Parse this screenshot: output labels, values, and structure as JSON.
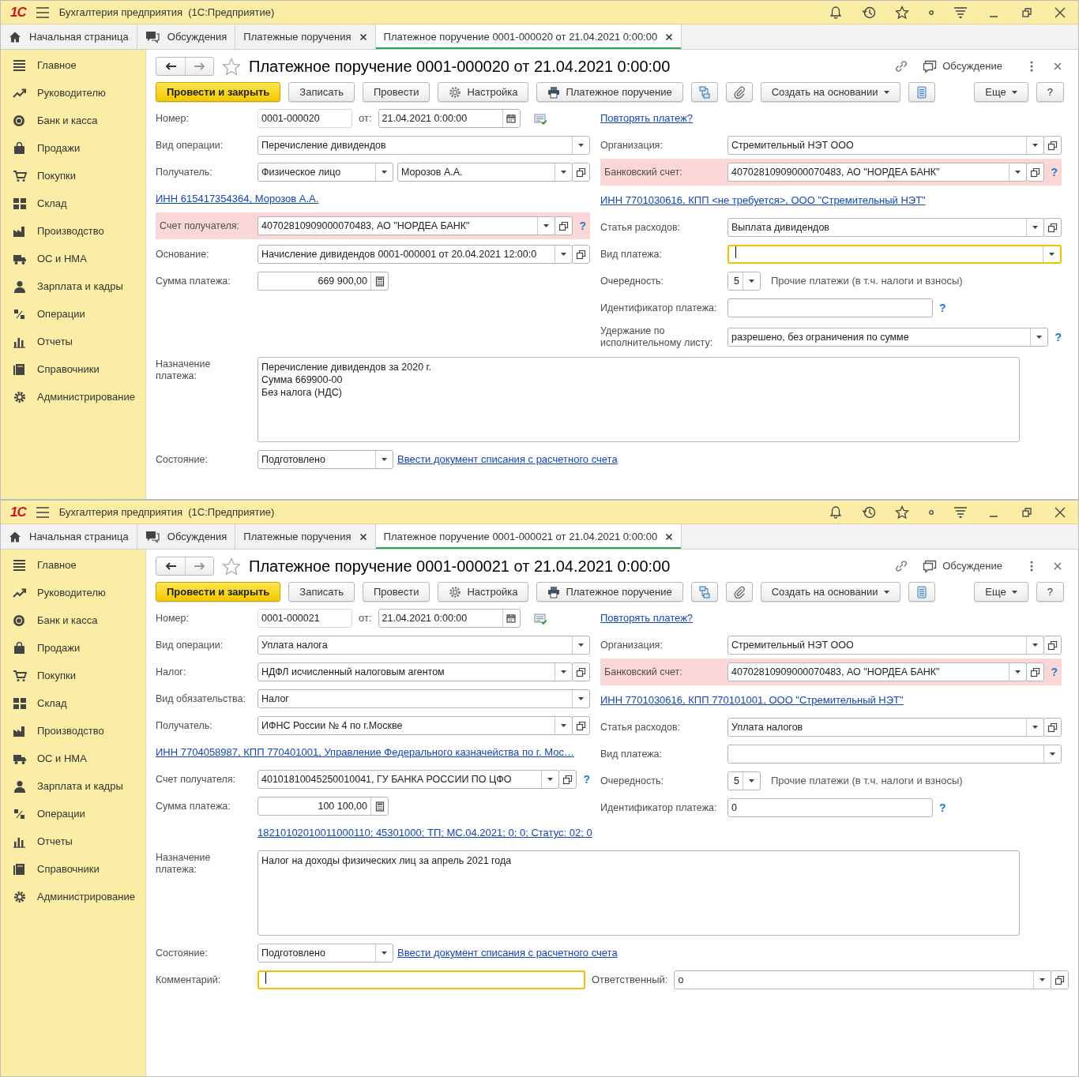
{
  "windows": [
    {
      "logo": "1С",
      "app_title": "Бухгалтерия предприятия  (1С:Предприятие)",
      "tabs": [
        {
          "label": "Начальная страница",
          "closable": false,
          "selected": false
        },
        {
          "label": "Обсуждения",
          "closable": false,
          "selected": false
        },
        {
          "label": "Платежные поручения",
          "closable": true,
          "selected": false
        },
        {
          "label": "Платежное поручение 0001-000020 от 21.04.2021 0:00:00",
          "closable": true,
          "selected": true
        }
      ],
      "sidebar": [
        "Главное",
        "Руководителю",
        "Банк и касса",
        "Продажи",
        "Покупки",
        "Склад",
        "Производство",
        "ОС и НМА",
        "Зарплата и кадры",
        "Операции",
        "Отчеты",
        "Справочники",
        "Администрирование"
      ],
      "form_title": "Платежное поручение 0001-000020 от 21.04.2021 0:00:00",
      "discussion": "Обсуждение",
      "toolbar": [
        {
          "kind": "primary",
          "label": "Провести и закрыть"
        },
        {
          "kind": "button",
          "label": "Записать"
        },
        {
          "kind": "button",
          "label": "Провести"
        },
        {
          "kind": "settings",
          "label": "Настройка"
        },
        {
          "kind": "print",
          "label": "Платежное поручение"
        },
        {
          "kind": "structure"
        },
        {
          "kind": "attach"
        },
        {
          "kind": "menu",
          "label": "Создать на основании"
        },
        {
          "kind": "list"
        }
      ],
      "toolbar_right": [
        {
          "kind": "menu",
          "label": "Еще"
        },
        {
          "kind": "button",
          "label": "?"
        }
      ],
      "form": {
        "left": [
          {
            "kind": "field",
            "label": "Номер:",
            "controls": [
              {
                "kind": "number",
                "value": "0001-000020"
              },
              {
                "kind": "label",
                "text": "от:"
              },
              {
                "kind": "date",
                "value": "21.04.2021  0:00:00"
              },
              {
                "kind": "doc-icon"
              }
            ]
          },
          {
            "kind": "field",
            "label": "Вид операции:",
            "controls": [
              {
                "kind": "select",
                "value": "Перечисление дивидендов",
                "dropdown": true
              }
            ]
          },
          {
            "kind": "field",
            "label": "Получатель:",
            "controls": [
              {
                "kind": "select-fixed",
                "value": "Физическое лицо",
                "dropdown": true
              },
              {
                "kind": "select",
                "value": "Морозов А.А.",
                "dropdown": true,
                "open_button": true
              }
            ]
          },
          {
            "kind": "link",
            "text": "ИНН 615417354364, Морозов А.А."
          },
          {
            "kind": "field",
            "label": "Счет получателя:",
            "highlighted": true,
            "controls": [
              {
                "kind": "select",
                "value": "40702810909000070483, АО \"НОРДЕА БАНК\"",
                "dropdown": true,
                "open_button": true
              },
              {
                "kind": "help",
                "text": "?"
              }
            ]
          },
          {
            "kind": "field",
            "label": "Основание:",
            "controls": [
              {
                "kind": "select",
                "value": "Начисление дивидендов 0001-000001 от 20.04.2021 12:00:0",
                "dropdown": true,
                "open_button": true
              }
            ]
          },
          {
            "kind": "field",
            "label": "Сумма платежа:",
            "controls": [
              {
                "kind": "amount",
                "value": "669 900,00"
              }
            ]
          }
        ],
        "right": [
          {
            "kind": "link",
            "text": "Повторять платеж?"
          },
          {
            "kind": "field",
            "label": "Организация:",
            "controls": [
              {
                "kind": "select",
                "value": "Стремительный НЭТ ООО",
                "dropdown": true,
                "open_button": true
              }
            ]
          },
          {
            "kind": "field",
            "label": "Банковский счет:",
            "highlighted": true,
            "controls": [
              {
                "kind": "select",
                "value": "40702810909000070483, АО \"НОРДЕА БАНК\"",
                "dropdown": true,
                "open_button": true
              },
              {
                "kind": "help",
                "text": "?"
              }
            ]
          },
          {
            "kind": "link",
            "text": "ИНН 7701030616, КПП <не требуется>, ООО \"Стремительный НЭТ\""
          },
          {
            "kind": "field",
            "label": "Статья расходов:",
            "controls": [
              {
                "kind": "select",
                "value": "Выплата дивидендов",
                "dropdown": true,
                "open_button": true
              }
            ]
          },
          {
            "kind": "field",
            "label": "Вид платежа:",
            "controls": [
              {
                "kind": "select",
                "focused": true,
                "dropdown": true
              }
            ]
          },
          {
            "kind": "field",
            "label": "Очередность:",
            "controls": [
              {
                "kind": "priority",
                "value": "5",
                "dropdown": true
              },
              {
                "kind": "note",
                "text": "Прочие платежи (в т.ч. налоги и взносы)"
              }
            ]
          },
          {
            "kind": "field",
            "label": "Идентификатор платежа:",
            "controls": [
              {
                "kind": "id"
              },
              {
                "kind": "help",
                "text": "?"
              }
            ]
          },
          {
            "kind": "field",
            "label": "Удержание по исполнительному листу:",
            "controls": [
              {
                "kind": "select",
                "value": "разрешено, без ограничения по сумме",
                "dropdown": true
              },
              {
                "kind": "help",
                "text": "?"
              }
            ]
          }
        ],
        "bottom": [
          {
            "kind": "field",
            "label": "Назначение платежа:",
            "controls": [
              {
                "kind": "textarea",
                "lines": [
                  "Перечисление дивидендов за 2020 г.",
                  "Сумма 669900-00",
                  "Без налога (НДС)"
                ]
              }
            ]
          },
          {
            "kind": "field",
            "label": "Состояние:",
            "controls": [
              {
                "kind": "select-fixed",
                "value": "Подготовлено",
                "dropdown": true
              },
              {
                "kind": "link",
                "text": "Ввести документ списания с расчетного счета"
              }
            ]
          }
        ]
      }
    },
    {
      "logo": "1С",
      "app_title": "Бухгалтерия предприятия  (1С:Предприятие)",
      "tabs": [
        {
          "label": "Начальная страница",
          "closable": false,
          "selected": false
        },
        {
          "label": "Обсуждения",
          "closable": false,
          "selected": false
        },
        {
          "label": "Платежные поручения",
          "closable": true,
          "selected": false
        },
        {
          "label": "Платежное поручение 0001-000021 от 21.04.2021 0:00:00",
          "closable": true,
          "selected": true
        }
      ],
      "sidebar": [
        "Главное",
        "Руководителю",
        "Банк и касса",
        "Продажи",
        "Покупки",
        "Склад",
        "Производство",
        "ОС и НМА",
        "Зарплата и кадры",
        "Операции",
        "Отчеты",
        "Справочники",
        "Администрирование"
      ],
      "form_title": "Платежное поручение 0001-000021 от 21.04.2021 0:00:00",
      "discussion": "Обсуждение",
      "toolbar": [
        {
          "kind": "primary",
          "label": "Провести и закрыть"
        },
        {
          "kind": "button",
          "label": "Записать"
        },
        {
          "kind": "button",
          "label": "Провести"
        },
        {
          "kind": "settings",
          "label": "Настройка"
        },
        {
          "kind": "print",
          "label": "Платежное поручение"
        },
        {
          "kind": "structure"
        },
        {
          "kind": "attach"
        },
        {
          "kind": "menu",
          "label": "Создать на основании"
        },
        {
          "kind": "list"
        }
      ],
      "toolbar_right": [
        {
          "kind": "menu",
          "label": "Еще"
        },
        {
          "kind": "button",
          "label": "?"
        }
      ],
      "form": {
        "left": [
          {
            "kind": "field",
            "label": "Номер:",
            "controls": [
              {
                "kind": "number",
                "value": "0001-000021"
              },
              {
                "kind": "label",
                "text": "от:"
              },
              {
                "kind": "date",
                "value": "21.04.2021  0:00:00"
              },
              {
                "kind": "doc-icon"
              }
            ]
          },
          {
            "kind": "field",
            "label": "Вид операции:",
            "controls": [
              {
                "kind": "select",
                "value": "Уплата налога",
                "dropdown": true
              }
            ]
          },
          {
            "kind": "field",
            "label": "Налог:",
            "controls": [
              {
                "kind": "select",
                "value": "НДФЛ исчисленный налоговым агентом",
                "dropdown": true,
                "open_button": true
              }
            ]
          },
          {
            "kind": "field",
            "label": "Вид обязательства:",
            "controls": [
              {
                "kind": "select",
                "value": "Налог",
                "dropdown": true
              }
            ]
          },
          {
            "kind": "field",
            "label": "Получатель:",
            "controls": [
              {
                "kind": "select",
                "value": "ИФНС России № 4 по г.Москве",
                "dropdown": true,
                "open_button": true
              }
            ]
          },
          {
            "kind": "link",
            "text": "ИНН 7704058987, КПП 770401001, Управление Федерального казначейства по г. Мос…"
          },
          {
            "kind": "field",
            "label": "Счет получателя:",
            "controls": [
              {
                "kind": "select",
                "value": "40101810045250010041, ГУ БАНКА РОССИИ ПО ЦФО",
                "dropdown": true,
                "open_button": true
              },
              {
                "kind": "help",
                "text": "?"
              }
            ]
          },
          {
            "kind": "field",
            "label": "Сумма платежа:",
            "controls": [
              {
                "kind": "amount",
                "value": "100 100,00"
              }
            ]
          },
          {
            "kind": "field",
            "controls": [
              {
                "kind": "link",
                "text": "18210102010011000110; 45301000; ТП; МС.04.2021; 0; 0; Статус: 02; 0"
              }
            ]
          }
        ],
        "right": [
          {
            "kind": "link",
            "text": "Повторять платеж?"
          },
          {
            "kind": "field",
            "label": "Организация:",
            "controls": [
              {
                "kind": "select",
                "value": "Стремительный НЭТ ООО",
                "dropdown": true,
                "open_button": true
              }
            ]
          },
          {
            "kind": "field",
            "label": "Банковский счет:",
            "highlighted": true,
            "controls": [
              {
                "kind": "select",
                "value": "40702810909000070483, АО \"НОРДЕА БАНК\"",
                "dropdown": true,
                "open_button": true
              },
              {
                "kind": "help",
                "text": "?"
              }
            ]
          },
          {
            "kind": "link",
            "text": "ИНН 7701030616, КПП 770101001, ООО \"Стремительный НЭТ\""
          },
          {
            "kind": "field",
            "label": "Статья расходов:",
            "controls": [
              {
                "kind": "select",
                "value": "Уплата налогов",
                "dropdown": true,
                "open_button": true
              }
            ]
          },
          {
            "kind": "field",
            "label": "Вид платежа:",
            "controls": [
              {
                "kind": "select",
                "dropdown": true
              }
            ]
          },
          {
            "kind": "field",
            "label": "Очередность:",
            "controls": [
              {
                "kind": "priority",
                "value": "5",
                "dropdown": true
              },
              {
                "kind": "note",
                "text": "Прочие платежи (в т.ч. налоги и взносы)"
              }
            ]
          },
          {
            "kind": "field",
            "label": "Идентификатор платежа:",
            "controls": [
              {
                "kind": "id",
                "value": "0"
              },
              {
                "kind": "help",
                "text": "?"
              }
            ]
          }
        ],
        "bottom": [
          {
            "kind": "field",
            "label": "Назначение платежа:",
            "controls": [
              {
                "kind": "textarea",
                "lines": [
                  "Налог на доходы физических лиц за апрель 2021 года"
                ]
              }
            ]
          },
          {
            "kind": "field",
            "label": "Состояние:",
            "controls": [
              {
                "kind": "select-fixed",
                "value": "Подготовлено",
                "dropdown": true
              },
              {
                "kind": "link",
                "text": "Ввести документ списания с расчетного счета"
              }
            ]
          },
          {
            "kind": "field",
            "label": "Комментарий:",
            "controls": [
              {
                "kind": "comment",
                "focused": true
              },
              {
                "kind": "label",
                "text": "Ответственный:"
              },
              {
                "kind": "select",
                "value": "о",
                "dropdown": true,
                "open_button": true
              }
            ]
          }
        ]
      }
    }
  ]
}
